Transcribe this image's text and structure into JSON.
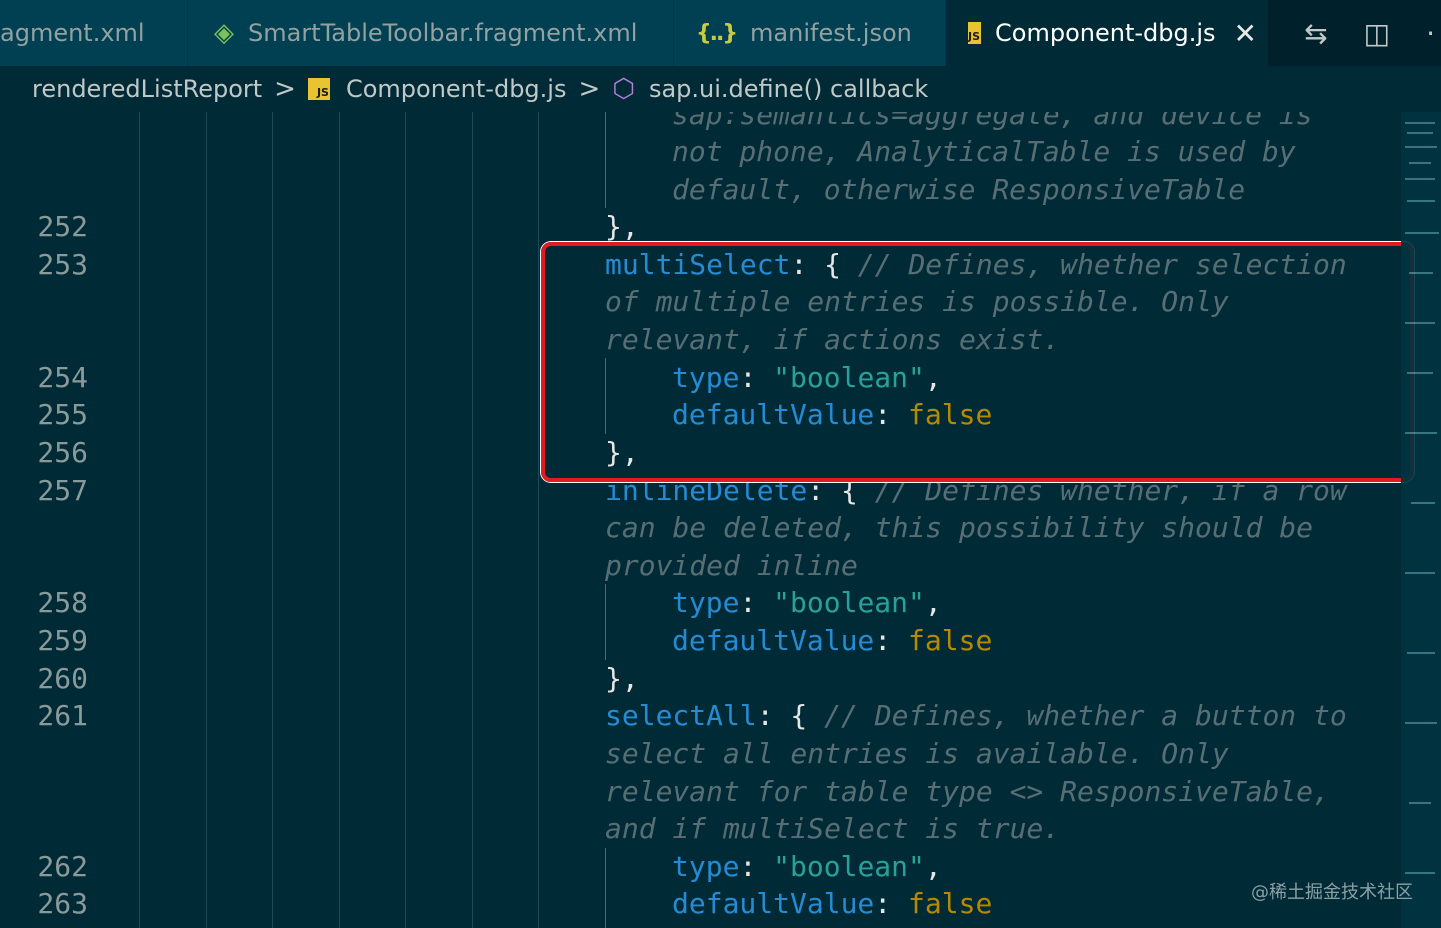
{
  "tabs": [
    {
      "label": "agment.xml",
      "icon": "none"
    },
    {
      "label": "SmartTableToolbar.fragment.xml",
      "icon": "xml-file-icon"
    },
    {
      "label": "manifest.json",
      "icon": "json-file-icon"
    },
    {
      "label": "Component-dbg.js",
      "icon": "js-file-icon",
      "active": true
    }
  ],
  "tab_actions": {
    "compare": "⇆",
    "split": "◫",
    "more": "·"
  },
  "icon_text": {
    "xml": "◈",
    "json": "{..}",
    "js": "JS",
    "close": "✕",
    "cube": "⬡",
    "chevron": ">"
  },
  "breadcrumb": {
    "part1": "renderedListReport",
    "part2": "Component-dbg.js",
    "part3": "sap.ui.define() callback"
  },
  "line_numbers": [
    "252",
    "253",
    "254",
    "255",
    "256",
    "257",
    "258",
    "259",
    "260",
    "261",
    "262",
    "263"
  ],
  "code": {
    "l0_cm": "sap:semantics=aggregate, and device is",
    "l1_cm": "not phone, AnalyticalTable is used by",
    "l2_cm": "default, otherwise ResponsiveTable",
    "l3_p": "},",
    "l4_k": "multiSelect",
    "l4_p": ": { ",
    "l4_cm": "// Defines, whether selection",
    "l5_cm": "of multiple entries is possible. Only",
    "l6_cm": "relevant, if actions exist.",
    "type_k": "type",
    "colon": ": ",
    "bool_s": "\"boolean\"",
    "comma": ",",
    "default_k": "defaultValue",
    "false_b": "false",
    "close_p": "},",
    "l10_k": "inlineDelete",
    "l10_p": ": { ",
    "l10_cm": "// Defines whether, if a row",
    "l11_cm": "can be deleted, this possibility should be",
    "l12_cm": "provided inline",
    "l16_k": "selectAll",
    "l16_p": ": { ",
    "l16_cm": "// Defines, whether a button to",
    "l17_cm": "select all entries is available. Only",
    "l18_cm": "relevant for table type <> ResponsiveTable,",
    "l19_cm": "and if multiSelect is true."
  },
  "watermark": "@稀土掘金技术社区",
  "colors": {
    "background": "#002b36",
    "keyword": "#268bd2",
    "string": "#2aa198",
    "boolean": "#b58900",
    "comment": "#586e75",
    "highlight": "#e01b24"
  }
}
